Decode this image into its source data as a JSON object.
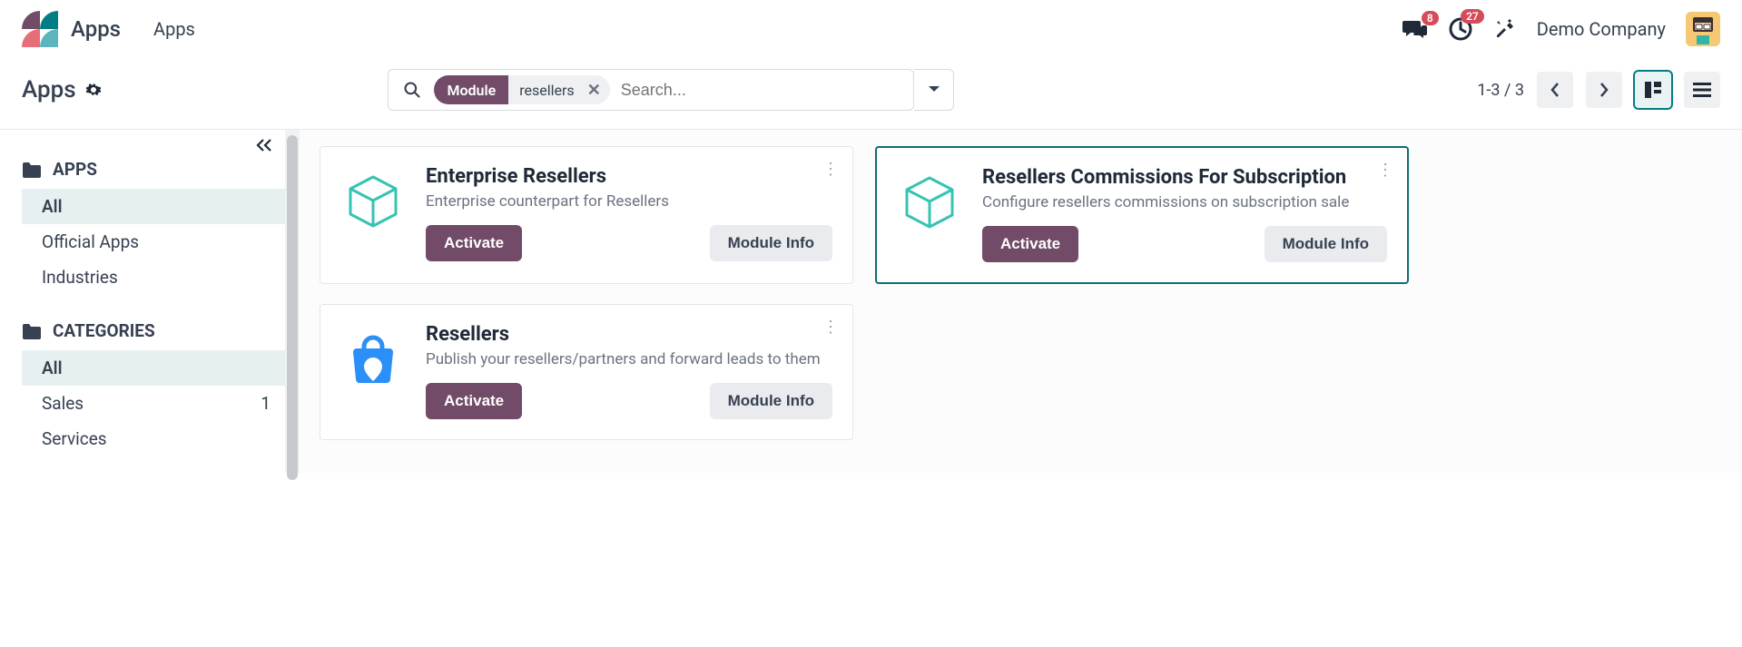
{
  "header": {
    "app_title": "Apps",
    "menu": [
      "Apps"
    ],
    "messages_badge": "8",
    "activities_badge": "27",
    "company": "Demo Company"
  },
  "controlbar": {
    "breadcrumb": "Apps",
    "search": {
      "facet_label": "Module",
      "facet_value": "resellers",
      "placeholder": "Search..."
    },
    "pager": "1-3 / 3"
  },
  "sidebar": {
    "apps_header": "APPS",
    "apps_items": [
      {
        "label": "All",
        "active": true
      },
      {
        "label": "Official Apps"
      },
      {
        "label": "Industries"
      }
    ],
    "categories_header": "CATEGORIES",
    "categories_items": [
      {
        "label": "All",
        "active": true
      },
      {
        "label": "Sales",
        "count": "1"
      },
      {
        "label": "Services"
      }
    ]
  },
  "cards": [
    {
      "title": "Enterprise Resellers",
      "desc": "Enterprise counterpart for Resellers",
      "activate": "Activate",
      "info": "Module Info",
      "icon": "cube",
      "selected": false
    },
    {
      "title": "Resellers Commissions For Subscription",
      "desc": "Configure resellers commissions on subscription sale",
      "activate": "Activate",
      "info": "Module Info",
      "icon": "cube",
      "selected": true
    },
    {
      "title": "Resellers",
      "desc": "Publish your resellers/partners and forward leads to them",
      "activate": "Activate",
      "info": "Module Info",
      "icon": "bag",
      "selected": false
    }
  ]
}
